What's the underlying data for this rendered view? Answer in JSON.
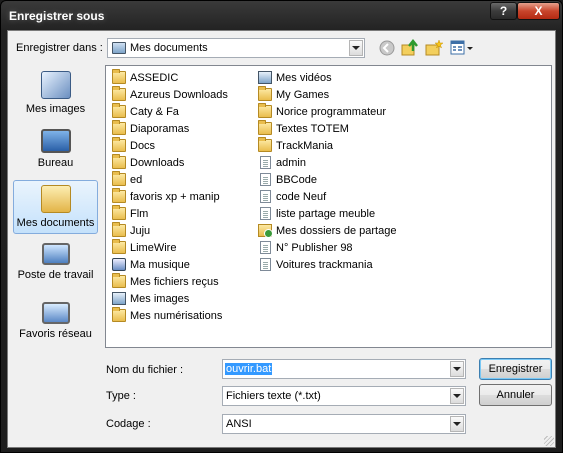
{
  "window": {
    "title": "Enregistrer sous",
    "help_label": "?",
    "close_label": "X"
  },
  "lookin": {
    "label": "Enregistrer dans :",
    "label_underline": "d",
    "value": "Mes documents"
  },
  "places": [
    {
      "label": "Mes images",
      "icon": "pictures-icon",
      "selected": false
    },
    {
      "label": "Bureau",
      "icon": "desktop-icon",
      "selected": false
    },
    {
      "label": "Mes documents",
      "icon": "documents-icon",
      "selected": true
    },
    {
      "label": "Poste de travail",
      "icon": "computer-icon",
      "selected": false
    },
    {
      "label": "Favoris réseau",
      "icon": "network-icon",
      "selected": false
    }
  ],
  "files": {
    "column1": [
      {
        "name": "ASSEDIC",
        "type": "folder"
      },
      {
        "name": "Azureus Downloads",
        "type": "folder"
      },
      {
        "name": "Caty  & Fa",
        "type": "folder"
      },
      {
        "name": "Diaporamas",
        "type": "folder"
      },
      {
        "name": "Docs",
        "type": "folder"
      },
      {
        "name": "Downloads",
        "type": "folder"
      },
      {
        "name": "ed",
        "type": "folder"
      },
      {
        "name": "favoris xp + manip",
        "type": "folder"
      },
      {
        "name": "Flm",
        "type": "folder"
      },
      {
        "name": "Juju",
        "type": "folder"
      },
      {
        "name": "LimeWire",
        "type": "folder"
      },
      {
        "name": "Ma musique",
        "type": "music"
      },
      {
        "name": "Mes fichiers reçus",
        "type": "folder"
      },
      {
        "name": "Mes images",
        "type": "special"
      },
      {
        "name": "Mes numérisations",
        "type": "folder"
      }
    ],
    "column2": [
      {
        "name": "Mes vidéos",
        "type": "special"
      },
      {
        "name": "My Games",
        "type": "folder"
      },
      {
        "name": "Norice programmateur",
        "type": "folder"
      },
      {
        "name": "Textes TOTEM",
        "type": "folder"
      },
      {
        "name": "TrackMania",
        "type": "folder"
      },
      {
        "name": "admin",
        "type": "doc"
      },
      {
        "name": "BBCode",
        "type": "doc"
      },
      {
        "name": "code Neuf",
        "type": "doc"
      },
      {
        "name": "liste partage meuble",
        "type": "doc"
      },
      {
        "name": "Mes dossiers de partage",
        "type": "share"
      },
      {
        "name": "N° Publisher 98",
        "type": "doc"
      },
      {
        "name": "Voitures trackmania",
        "type": "doc"
      }
    ]
  },
  "form": {
    "filename_label": "Nom du fichier :",
    "filename_value": "ouvrir.bat",
    "type_label": "Type :",
    "type_value": "Fichiers texte (*.txt)",
    "encoding_label": "Codage :",
    "encoding_value": "ANSI"
  },
  "buttons": {
    "save": "Enregistrer",
    "cancel": "Annuler"
  }
}
